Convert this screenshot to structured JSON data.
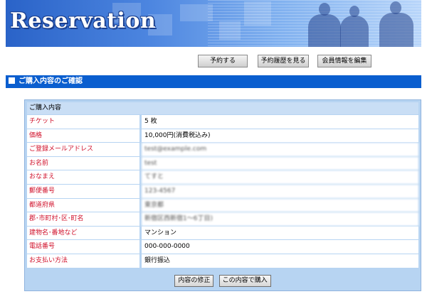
{
  "header": {
    "title": "Reservation"
  },
  "nav": {
    "reserve_label": "予約する",
    "history_label": "予約履歴を見る",
    "edit_member_label": "会員情報を編集"
  },
  "section": {
    "title": "ご購入内容のご確認"
  },
  "purchase": {
    "heading": "ご購入内容",
    "rows": [
      {
        "label": "チケット",
        "value": "5 枚"
      },
      {
        "label": "価格",
        "value": "10,000円(消費税込み)"
      },
      {
        "label": "ご登録メールアドレス",
        "value": "test@example.com"
      },
      {
        "label": "お名前",
        "value": "test"
      },
      {
        "label": "おなまえ",
        "value": "てすと"
      },
      {
        "label": "郵便番号",
        "value": "123-4567"
      },
      {
        "label": "都道府県",
        "value": "東京都"
      },
      {
        "label": "郡･市町村･区･町名",
        "value": "新宿区西新宿1〜6丁目)"
      },
      {
        "label": "建物名･番地など",
        "value": "マンション"
      },
      {
        "label": "電話番号",
        "value": "000-000-0000"
      },
      {
        "label": "お支払い方法",
        "value": "銀行振込"
      }
    ],
    "blurred_rows": [
      2,
      3,
      4,
      5,
      6,
      7
    ]
  },
  "actions": {
    "edit_label": "内容の修正",
    "purchase_label": "この内容で購入"
  },
  "colors": {
    "section_bar": "#0a5ecf",
    "label_text": "#d0102a",
    "panel_bg": "#b7d4f2"
  }
}
